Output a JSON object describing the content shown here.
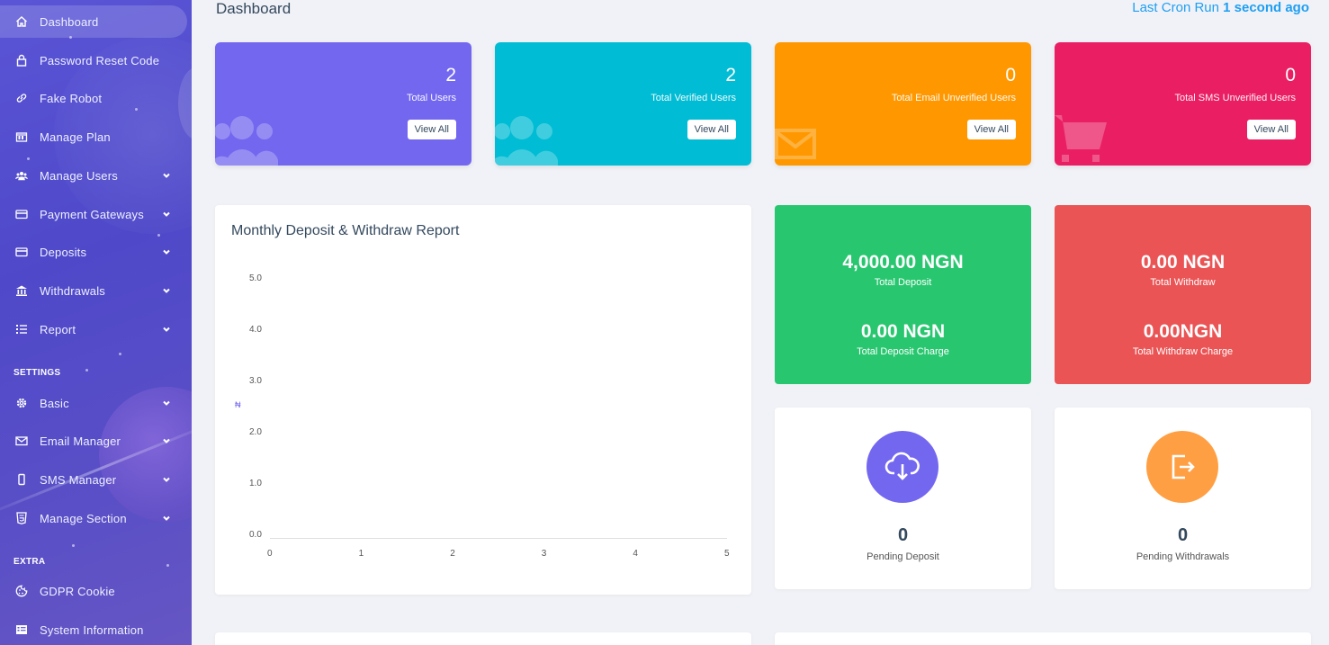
{
  "sidebar": {
    "items": [
      {
        "label": "Dashboard",
        "icon": "home-icon",
        "has_submenu": false,
        "active": true
      },
      {
        "label": "Password Reset Code",
        "icon": "lock-icon",
        "has_submenu": false
      },
      {
        "label": "Fake Robot",
        "icon": "link-icon",
        "has_submenu": false
      },
      {
        "label": "Manage Plan",
        "icon": "plan-icon",
        "has_submenu": false
      },
      {
        "label": "Manage Users",
        "icon": "users-icon",
        "has_submenu": true
      },
      {
        "label": "Payment Gateways",
        "icon": "credit-card-icon",
        "has_submenu": true
      },
      {
        "label": "Deposits",
        "icon": "credit-card-icon",
        "has_submenu": true
      },
      {
        "label": "Withdrawals",
        "icon": "bank-icon",
        "has_submenu": true
      },
      {
        "label": "Report",
        "icon": "list-icon",
        "has_submenu": true
      }
    ],
    "settings_heading": "SETTINGS",
    "settings_items": [
      {
        "label": "Basic",
        "icon": "gear-icon",
        "has_submenu": true
      },
      {
        "label": "Email Manager",
        "icon": "envelope-icon",
        "has_submenu": true
      },
      {
        "label": "SMS Manager",
        "icon": "mobile-icon",
        "has_submenu": true
      },
      {
        "label": "Manage Section",
        "icon": "html5-icon",
        "has_submenu": true
      }
    ],
    "extra_heading": "EXTRA",
    "extra_items": [
      {
        "label": "GDPR Cookie",
        "icon": "cookie-icon",
        "has_submenu": false
      },
      {
        "label": "System Information",
        "icon": "server-icon",
        "has_submenu": false
      }
    ]
  },
  "header": {
    "title": "Dashboard",
    "cron_prefix": "Last Cron Run",
    "cron_value": "1 second ago"
  },
  "stats": [
    {
      "value": "2",
      "label": "Total Users",
      "button": "View All",
      "color": "#7367f0",
      "icon": "users-icon"
    },
    {
      "value": "2",
      "label": "Total Verified Users",
      "button": "View All",
      "color": "#00bcd4",
      "icon": "users-icon"
    },
    {
      "value": "0",
      "label": "Total Email Unverified Users",
      "button": "View All",
      "color": "#ff9800",
      "icon": "envelope-icon"
    },
    {
      "value": "0",
      "label": "Total SMS Unverified Users",
      "button": "View All",
      "color": "#ea1e63",
      "icon": "cart-icon"
    }
  ],
  "report": {
    "title": "Monthly Deposit & Withdraw Report",
    "y_axis_label": "₦"
  },
  "chart_data": {
    "type": "line",
    "title": "Monthly Deposit & Withdraw Report",
    "ylabel": "₦",
    "x_ticks": [
      "0",
      "1",
      "2",
      "3",
      "4",
      "5"
    ],
    "y_ticks": [
      "0.0",
      "1.0",
      "2.0",
      "3.0",
      "4.0",
      "5.0"
    ],
    "xlim": [
      0,
      5
    ],
    "ylim": [
      0,
      5
    ],
    "series": []
  },
  "money": {
    "deposit": {
      "value": "4,000.00 NGN",
      "label": "Total Deposit",
      "charge_value": "0.00 NGN",
      "charge_label": "Total Deposit Charge",
      "color": "#28c76f"
    },
    "withdraw": {
      "value": "0.00 NGN",
      "label": "Total Withdraw",
      "charge_value": "0.00NGN",
      "charge_label": "Total Withdraw Charge",
      "color": "#ea5455"
    }
  },
  "pending": {
    "deposit": {
      "value": "0",
      "label": "Pending Deposit",
      "color": "#7367f0",
      "icon": "cloud-download-icon"
    },
    "withdraw": {
      "value": "0",
      "label": "Pending Withdrawals",
      "color": "#ff9f43",
      "icon": "sign-out-icon"
    }
  }
}
